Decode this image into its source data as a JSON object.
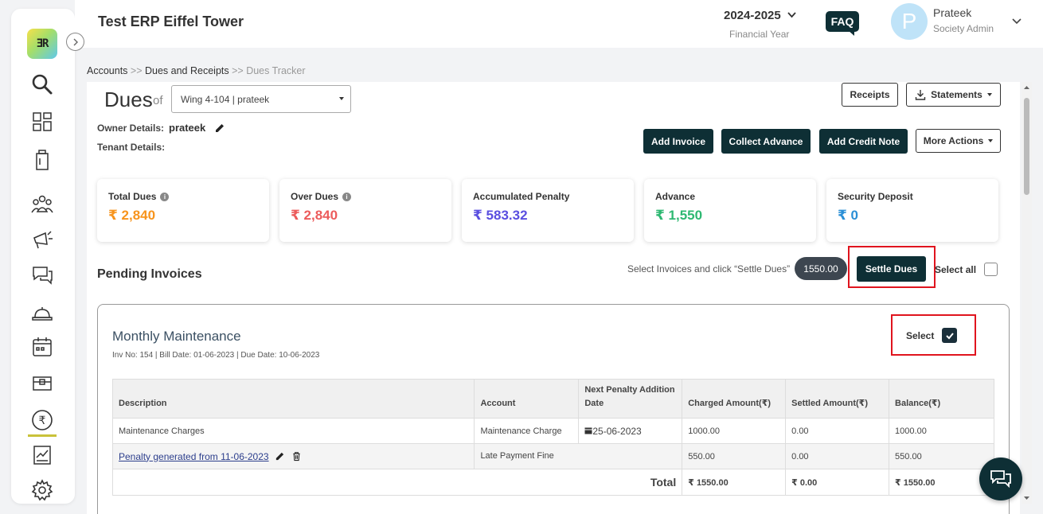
{
  "header": {
    "app_title": "Test ERP Eiffel Tower",
    "financial_year": "2024-2025",
    "financial_year_label": "Financial Year",
    "faq_label": "FAQ",
    "avatar_letter": "P",
    "user_name": "Prateek",
    "user_role": "Society Admin"
  },
  "breadcrumb": {
    "item1": "Accounts",
    "sep": ">>",
    "item2": "Dues and Receipts",
    "item3": "Dues Tracker"
  },
  "sidebar": {
    "logo_text": "ƎR",
    "icons": [
      "search-icon",
      "dashboard-icon",
      "building-icon",
      "people-icon",
      "megaphone-icon",
      "chat-icon",
      "service-icon",
      "calendar-icon",
      "box-icon",
      "rupee-icon",
      "report-icon",
      "settings-icon"
    ]
  },
  "dues": {
    "title": "Dues",
    "of": "of",
    "unit_selected": "Wing 4-104 | prateek",
    "owner_label": "Owner Details:",
    "owner_name": "prateek",
    "tenant_label": "Tenant Details:"
  },
  "actions": {
    "receipts": "Receipts",
    "statements": "Statements",
    "add_invoice": "Add Invoice",
    "collect_advance": "Collect Advance",
    "add_credit_note": "Add Credit Note",
    "more_actions": "More Actions"
  },
  "summary_cards": [
    {
      "label": "Total Dues",
      "value": "₹ 2,840",
      "color": "#f7941d",
      "info": true
    },
    {
      "label": "Over Dues",
      "value": "₹ 2,840",
      "color": "#ec5b5b",
      "info": true
    },
    {
      "label": "Accumulated Penalty",
      "value": "₹ 583.32",
      "color": "#5a4fe0",
      "info": false
    },
    {
      "label": "Advance",
      "value": "₹ 1,550",
      "color": "#2eb872",
      "info": false
    },
    {
      "label": "Security Deposit",
      "value": "₹ 0",
      "color": "#2a8fd6",
      "info": false
    }
  ],
  "pending": {
    "title": "Pending Invoices",
    "hint": "Select Invoices and click “Settle Dues”",
    "amount": "1550.00",
    "settle_button": "Settle Dues",
    "select_all": "Select all"
  },
  "invoice": {
    "title": "Monthly Maintenance",
    "meta": "Inv No: 154 | Bill Date: 01-06-2023 | Due Date: 10-06-2023",
    "select_label": "Select",
    "selected": true,
    "columns": [
      "Description",
      "Account",
      "Next Penalty Addition Date",
      "Charged Amount(₹)",
      "Settled Amount(₹)",
      "Balance(₹)"
    ],
    "rows": [
      {
        "description": "Maintenance Charges",
        "account": "Maintenance Charge",
        "next_penalty": "25-06-2023",
        "charged": "1000.00",
        "settled": "0.00",
        "balance": "1000.00"
      },
      {
        "description": "Penalty generated from 11-06-2023",
        "account": "Late Payment Fine",
        "next_penalty": "",
        "charged": "550.00",
        "settled": "0.00",
        "balance": "550.00"
      }
    ],
    "total": {
      "label": "Total",
      "charged": "₹ 1550.00",
      "settled": "₹ 0.00",
      "balance": "₹ 1550.00"
    }
  }
}
